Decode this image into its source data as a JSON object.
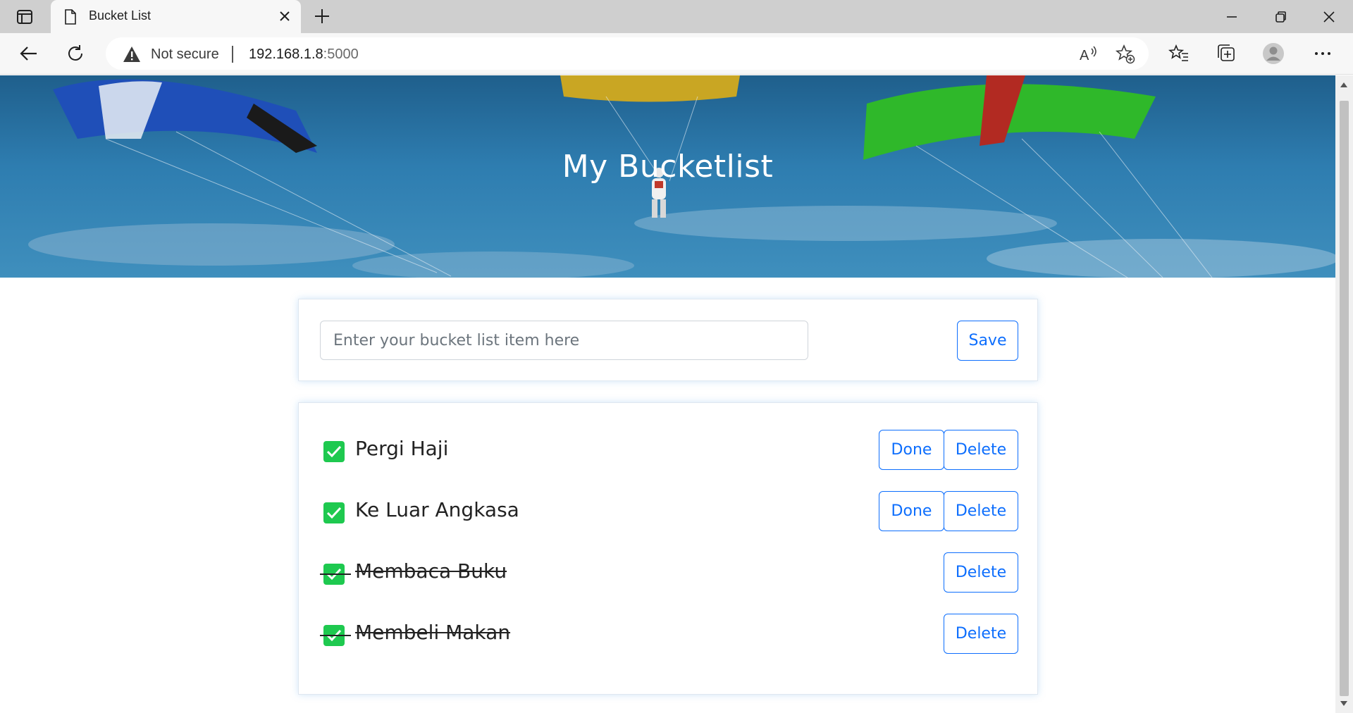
{
  "browser": {
    "tab_title": "Bucket List",
    "security_label": "Not secure",
    "url_host": "192.168.1.8",
    "url_port": ":5000"
  },
  "hero": {
    "title": "My Bucketlist"
  },
  "form": {
    "placeholder": "Enter your bucket list item here",
    "save_label": "Save"
  },
  "items": [
    {
      "text": "Pergi Haji",
      "done": false,
      "done_label": "Done",
      "delete_label": "Delete"
    },
    {
      "text": "Ke Luar Angkasa",
      "done": false,
      "done_label": "Done",
      "delete_label": "Delete"
    },
    {
      "text": "Membaca Buku",
      "done": true,
      "delete_label": "Delete"
    },
    {
      "text": "Membeli Makan",
      "done": true,
      "delete_label": "Delete"
    }
  ],
  "colors": {
    "accent": "#0d6efd",
    "check": "#1ec94f",
    "sky": "#2e7db0"
  }
}
